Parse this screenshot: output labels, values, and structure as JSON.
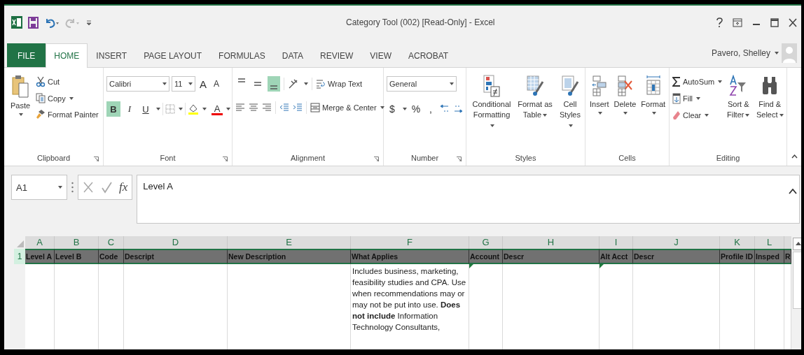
{
  "window": {
    "title": "Category Tool (002)  [Read-Only] - Excel"
  },
  "user": {
    "name": "Pavero, Shelley"
  },
  "tabs": [
    {
      "label": "FILE",
      "kind": "file",
      "selected": false
    },
    {
      "label": "HOME",
      "kind": "tab",
      "selected": true
    },
    {
      "label": "INSERT",
      "kind": "tab",
      "selected": false
    },
    {
      "label": "PAGE LAYOUT",
      "kind": "tab",
      "selected": false
    },
    {
      "label": "FORMULAS",
      "kind": "tab",
      "selected": false
    },
    {
      "label": "DATA",
      "kind": "tab",
      "selected": false
    },
    {
      "label": "REVIEW",
      "kind": "tab",
      "selected": false
    },
    {
      "label": "VIEW",
      "kind": "tab",
      "selected": false
    },
    {
      "label": "ACROBAT",
      "kind": "tab",
      "selected": false
    }
  ],
  "clipboard": {
    "label": "Clipboard",
    "paste": "Paste",
    "cut": "Cut",
    "copy": "Copy",
    "format_painter": "Format Painter"
  },
  "font": {
    "label": "Font",
    "font_name": "Calibri",
    "font_size": "11",
    "grow": "A",
    "shrink": "A",
    "styles": [
      {
        "label": "B",
        "kind": "bold",
        "on": true
      },
      {
        "label": "I",
        "kind": "italic",
        "on": false
      },
      {
        "label": "U",
        "kind": "underline",
        "on": false
      }
    ],
    "font_color": "A"
  },
  "alignment": {
    "label": "Alignment",
    "vertical": [
      {
        "selected": false
      },
      {
        "selected": false
      },
      {
        "selected": true
      }
    ],
    "wrap_text": "Wrap Text",
    "merge_center": "Merge & Center"
  },
  "number": {
    "label": "Number",
    "format": "General",
    "currency": "$",
    "percent": "%",
    "comma": ","
  },
  "styles": {
    "label": "Styles",
    "buttons": [
      "Conditional Formatting",
      "Format as Table",
      "Cell Styles"
    ]
  },
  "cells": {
    "label": "Cells",
    "buttons": [
      "Insert",
      "Delete",
      "Format"
    ]
  },
  "editing": {
    "label": "Editing",
    "autosum": "AutoSum",
    "fill": "Fill",
    "clear": "Clear",
    "sort_filter": "Sort & Filter",
    "find_select": "Find & Select"
  },
  "formula_bar": {
    "name_box": "A1",
    "function_label": "fx",
    "value": "Level A"
  },
  "sheet": {
    "columns": [
      "A",
      "B",
      "C",
      "D",
      "E",
      "F",
      "G",
      "H",
      "I",
      "J",
      "K",
      "L"
    ],
    "rows": [
      {
        "number": "1",
        "selected": true,
        "cells": [
          {
            "text": "Level A",
            "flagged": false
          },
          {
            "text": "Level B",
            "flagged": false
          },
          {
            "text": "Code",
            "flagged": false
          },
          {
            "text": "Descript",
            "flagged": false
          },
          {
            "text": "New Description",
            "flagged": false
          },
          {
            "text": "What Applies",
            "flagged": false
          },
          {
            "text": "Account",
            "flagged": false
          },
          {
            "text": "Descr",
            "flagged": false
          },
          {
            "text": "Alt Acct",
            "flagged": false
          },
          {
            "text": "Descr",
            "flagged": false
          },
          {
            "text": "Profile ID",
            "flagged": false
          },
          {
            "text": "Insped",
            "flagged": false
          },
          {
            "text": "R",
            "flagged": false
          }
        ]
      },
      {
        "selected": false,
        "cells": [
          {
            "flagged": false
          },
          {
            "flagged": false
          },
          {
            "flagged": false
          },
          {
            "flagged": false
          },
          {
            "flagged": false
          },
          {
            "text": "Includes business, marketing, feasibility studies and CPA.  Use when recommendations may or may not be put into use.  **Does not include** Information Technology Consultants,",
            "flagged": false
          },
          {
            "flagged": true
          },
          {
            "flagged": false
          },
          {
            "flagged": true
          },
          {
            "flagged": false
          },
          {
            "flagged": false
          },
          {
            "flagged": false
          },
          {
            "flagged": false
          }
        ]
      }
    ]
  }
}
